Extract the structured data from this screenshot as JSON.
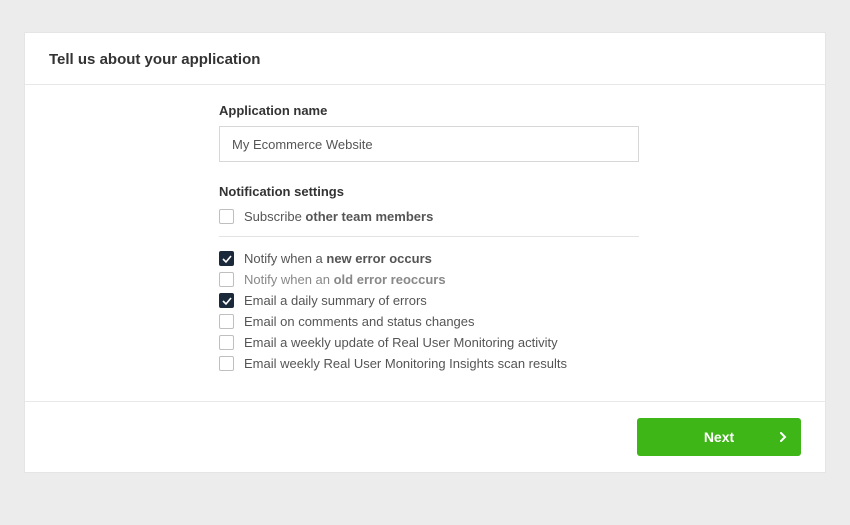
{
  "header": {
    "title": "Tell us about your application"
  },
  "appName": {
    "label": "Application name",
    "value": "My Ecommerce Website"
  },
  "notifications": {
    "label": "Notification settings",
    "subscribe": {
      "prefix": "Subscribe ",
      "bold": "other team members",
      "checked": false
    },
    "items": [
      {
        "prefix": "Notify when a ",
        "bold": "new error occurs",
        "suffix": "",
        "checked": true,
        "muted": false
      },
      {
        "prefix": "Notify when an ",
        "bold": "old error reoccurs",
        "suffix": "",
        "checked": false,
        "muted": true
      },
      {
        "prefix": "Email a daily summary of errors",
        "bold": "",
        "suffix": "",
        "checked": true,
        "muted": false
      },
      {
        "prefix": "Email on comments and status changes",
        "bold": "",
        "suffix": "",
        "checked": false,
        "muted": false
      },
      {
        "prefix": "Email a weekly update of Real User Monitoring activity",
        "bold": "",
        "suffix": "",
        "checked": false,
        "muted": false
      },
      {
        "prefix": "Email weekly Real User Monitoring Insights scan results",
        "bold": "",
        "suffix": "",
        "checked": false,
        "muted": false
      }
    ]
  },
  "footer": {
    "next": "Next"
  }
}
